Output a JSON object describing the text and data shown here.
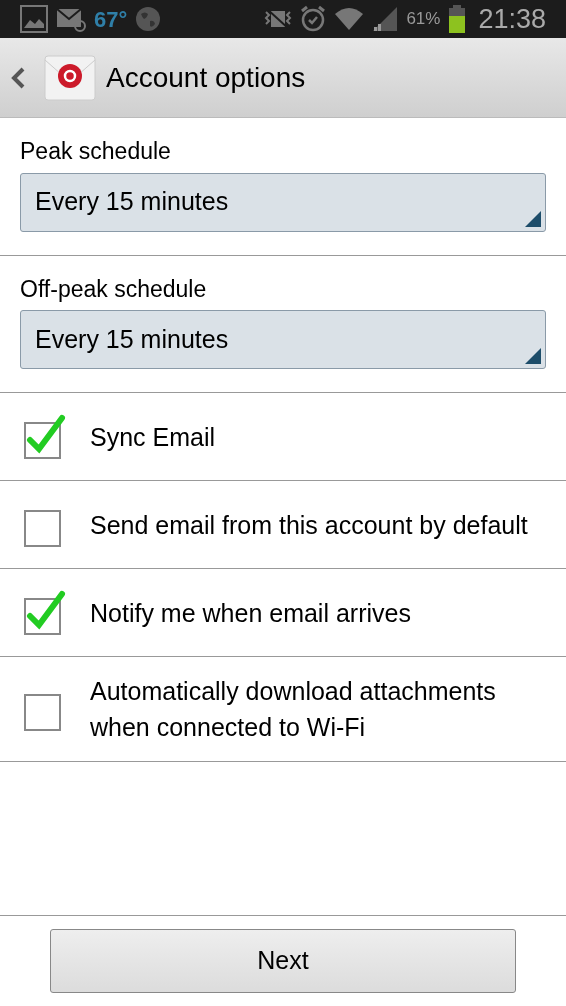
{
  "status_bar": {
    "temperature": "67°",
    "battery": "61%",
    "time": "21:38"
  },
  "header": {
    "title": "Account options"
  },
  "schedules": [
    {
      "label": "Peak schedule",
      "value": "Every 15 minutes"
    },
    {
      "label": "Off-peak schedule",
      "value": "Every 15 minutes"
    }
  ],
  "options": [
    {
      "label": "Sync Email",
      "checked": true
    },
    {
      "label": "Send email from this account by default",
      "checked": false
    },
    {
      "label": "Notify me when email arrives",
      "checked": true
    },
    {
      "label": "Automatically download attachments when connected to Wi-Fi",
      "checked": false
    }
  ],
  "buttons": [
    "Next"
  ]
}
